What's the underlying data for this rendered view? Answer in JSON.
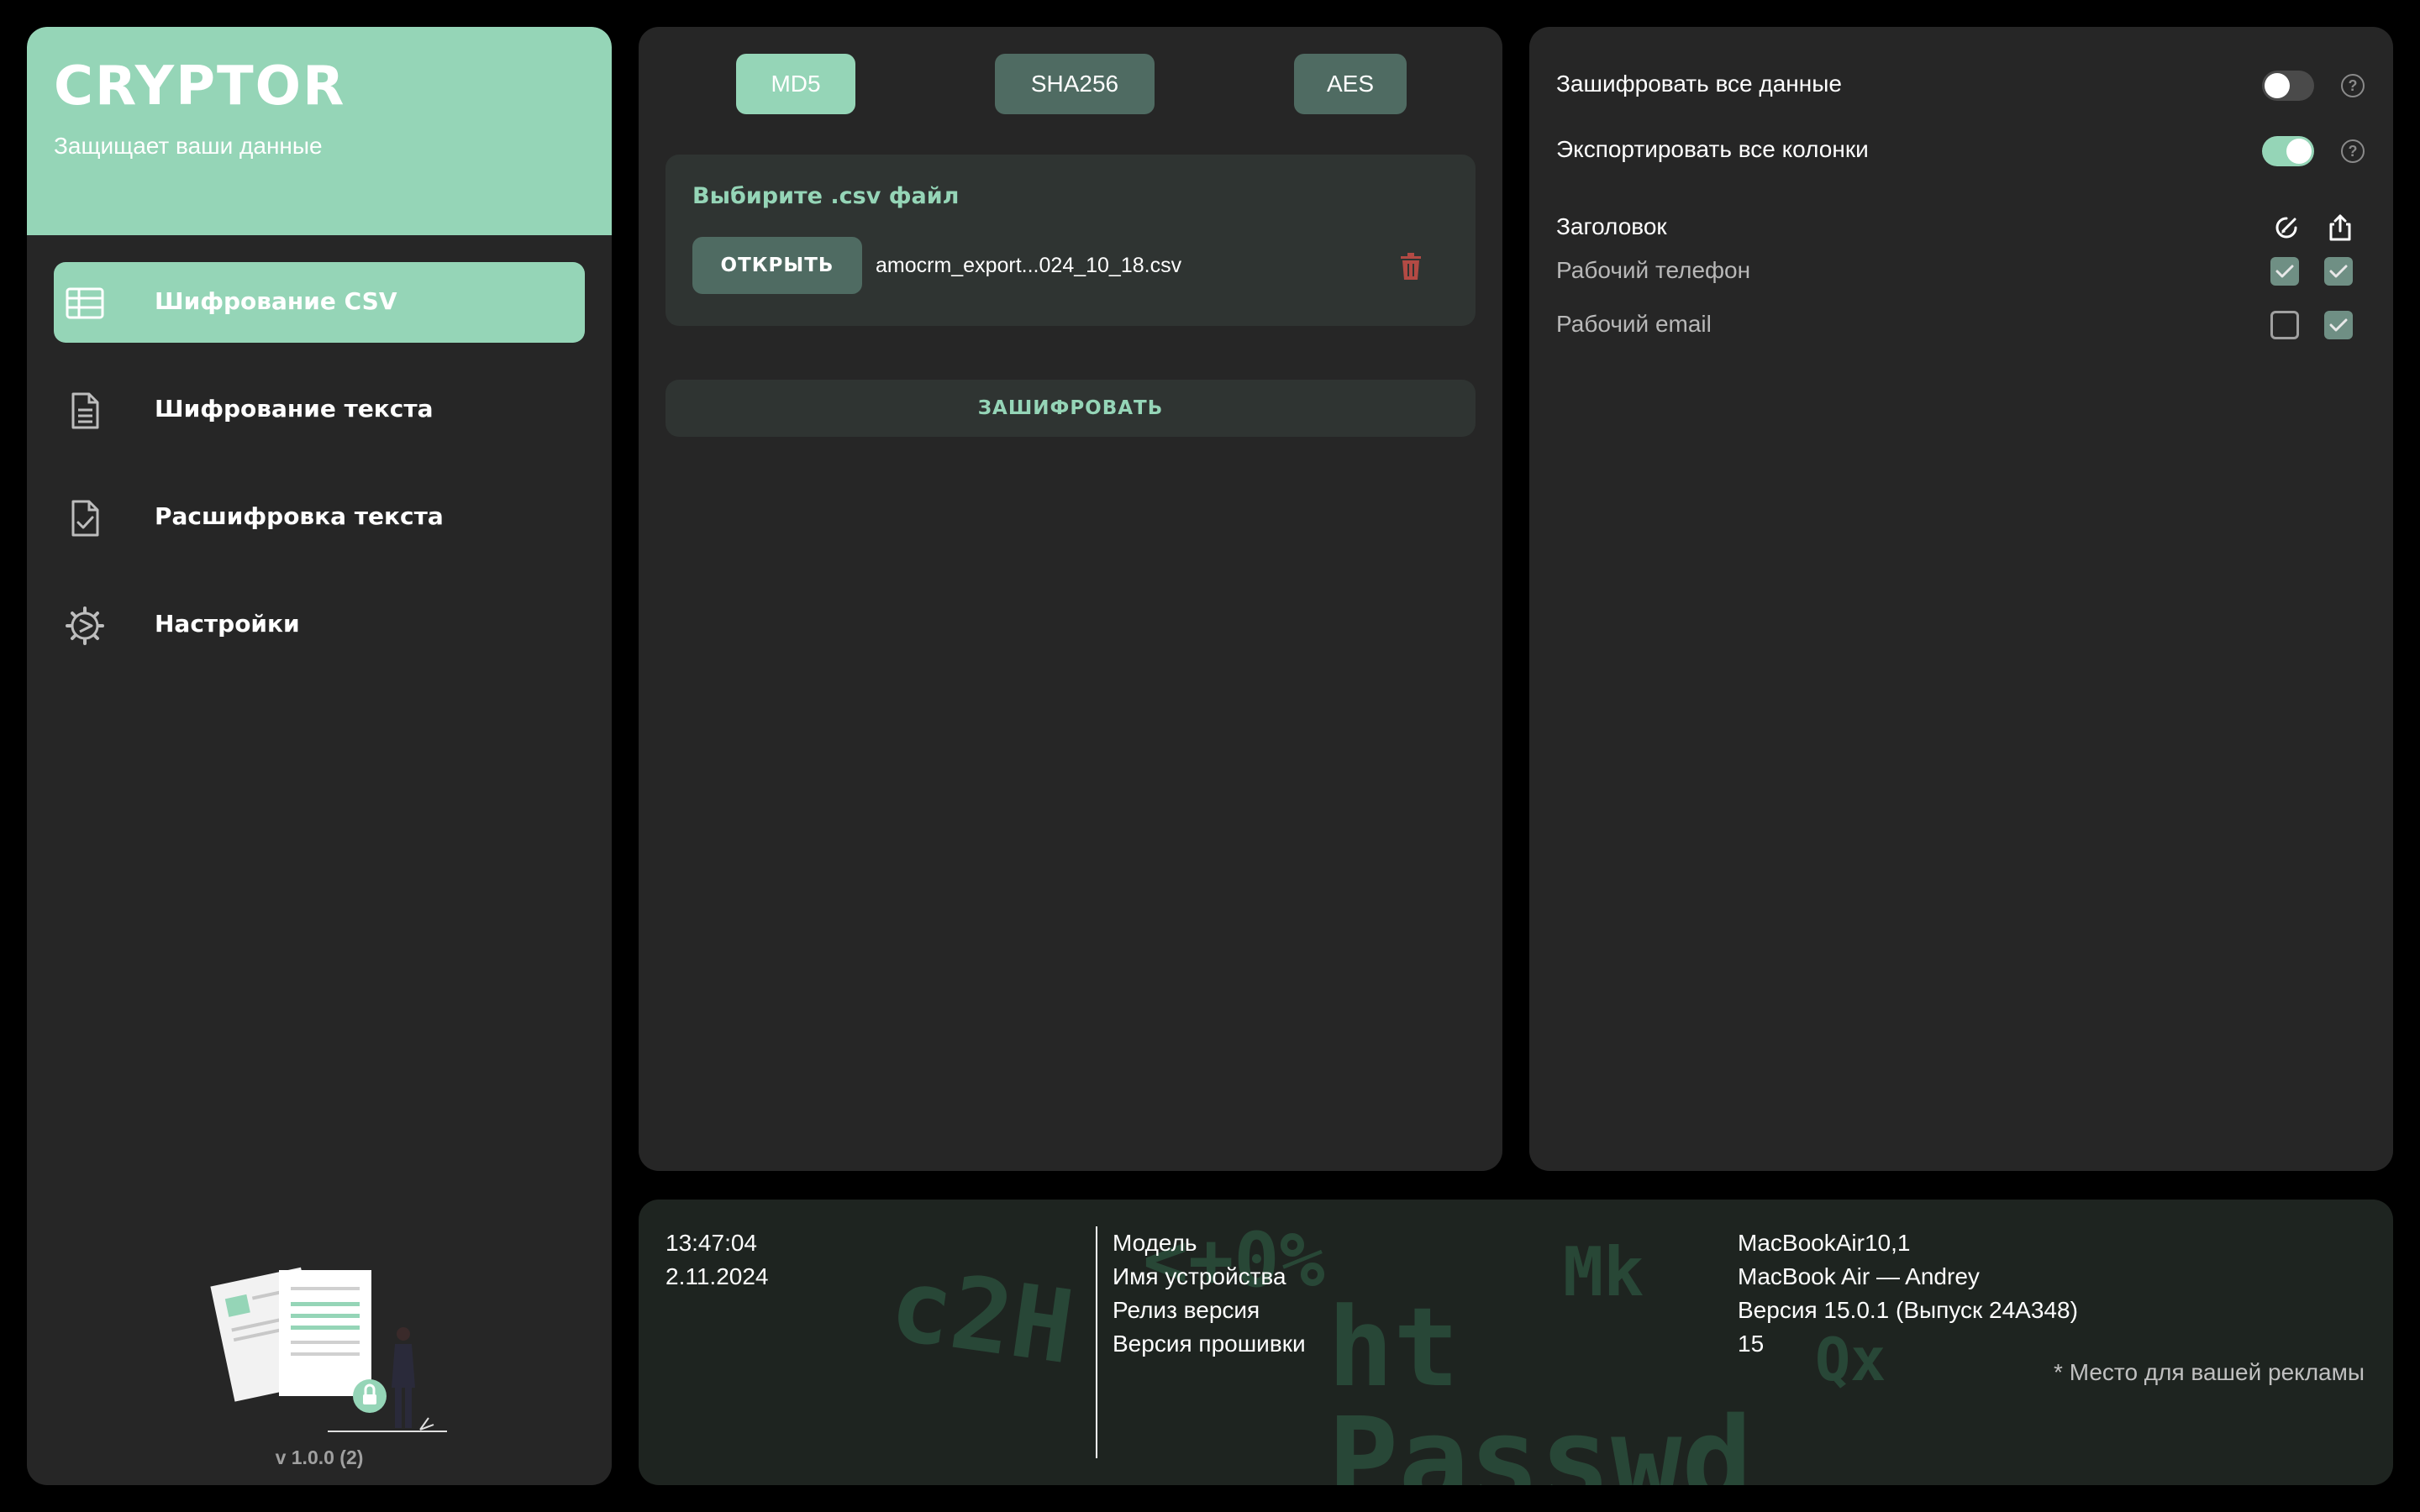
{
  "app": {
    "title": "CRYPTOR",
    "subtitle": "Защищает ваши данные",
    "version": "v 1.0.0 (2)"
  },
  "sidebar": {
    "items": [
      {
        "label": "Шифрование CSV",
        "icon": "table-icon",
        "active": true
      },
      {
        "label": "Шифрование текста",
        "icon": "document-icon",
        "active": false
      },
      {
        "label": "Расшифровка текста",
        "icon": "document-check-icon",
        "active": false
      },
      {
        "label": "Настройки",
        "icon": "gear-icon",
        "active": false
      }
    ]
  },
  "algorithms": {
    "items": [
      "MD5",
      "SHA256",
      "AES"
    ],
    "selected": "MD5"
  },
  "file": {
    "title": "Выбирите .csv файл",
    "open_label": "ОТКРЫТЬ",
    "filename": "amocrm_export...024_10_18.csv"
  },
  "encrypt_label": "ЗАШИФРОВАТЬ",
  "options": {
    "encrypt_all": {
      "label": "Зашифровать все данные",
      "enabled": false
    },
    "export_all": {
      "label": "Экспортировать все колонки",
      "enabled": true
    },
    "header_label": "Заголовок",
    "rows": [
      {
        "label": "Рабочий телефон",
        "encrypt": true,
        "export": true
      },
      {
        "label": "Рабочий email",
        "encrypt": false,
        "export": true
      }
    ]
  },
  "system": {
    "time": "13:47:04",
    "date": "2.11.2024",
    "labels": [
      "Модель",
      "Имя устройства",
      "Релиз версия",
      "Версия прошивки"
    ],
    "values": [
      "MacBookAir10,1",
      "MacBook Air — Andrey",
      "Версия 15.0.1 (Выпуск 24A348)",
      "15"
    ],
    "ad": "* Место для вашей рекламы"
  },
  "colors": {
    "accent": "#95d5b7",
    "button_dark": "#4f6b62",
    "panel": "#262626",
    "background": "#000000",
    "danger": "#b24a44"
  }
}
